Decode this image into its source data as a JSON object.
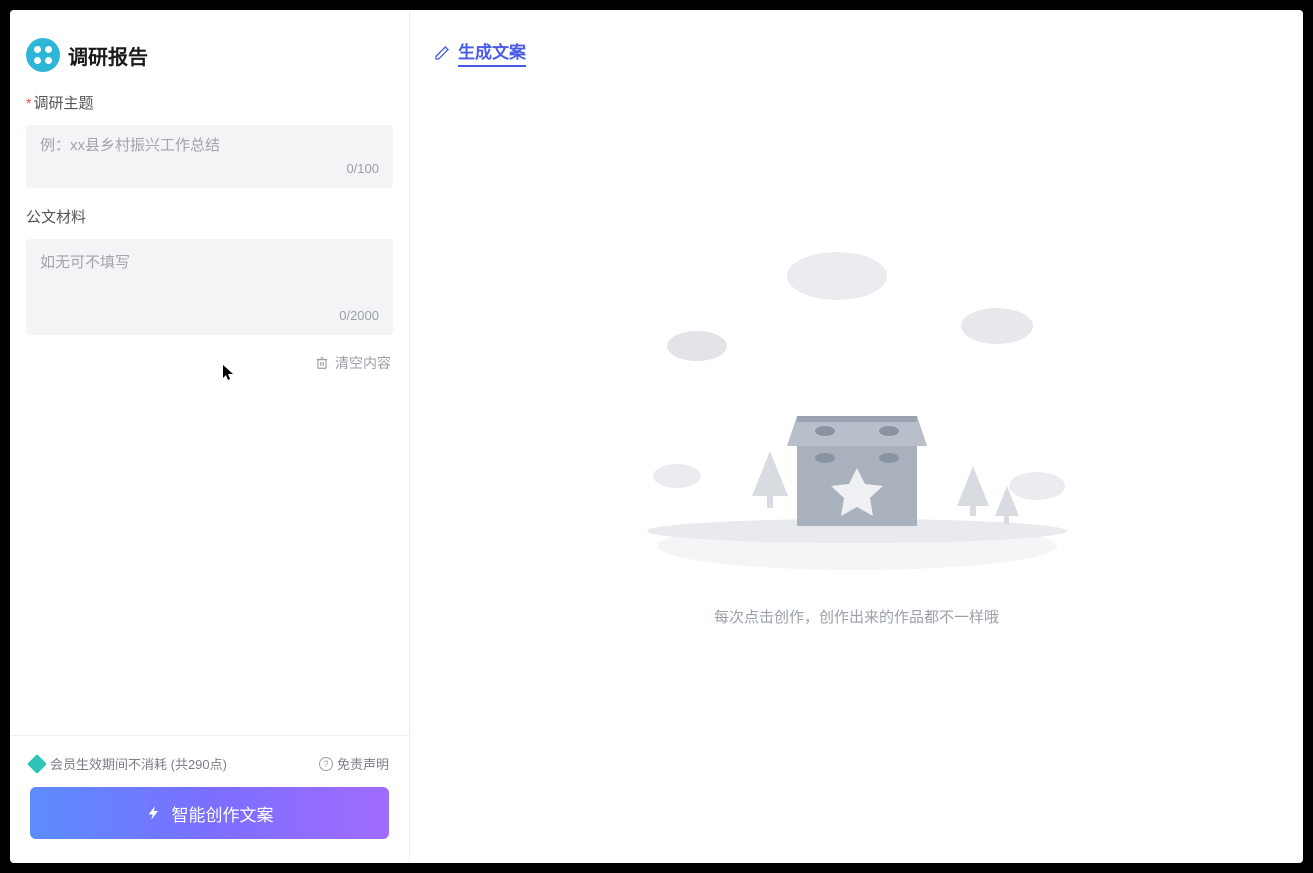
{
  "sidebar": {
    "title": "调研报告",
    "field1": {
      "label": "调研主题",
      "required": true,
      "placeholder": "例：xx县乡村振兴工作总结",
      "value": "",
      "count": "0/100"
    },
    "field2": {
      "label": "公文材料",
      "required": false,
      "placeholder": "如无可不填写",
      "value": "",
      "count": "0/2000"
    },
    "clear_label": "清空内容",
    "credits_label": "会员生效期间不消耗 (共290点)",
    "disclaimer_label": "免责声明",
    "generate_label": "智能创作文案"
  },
  "main": {
    "header_title": "生成文案",
    "empty_text": "每次点击创作，创作出来的作品都不一样哦"
  }
}
